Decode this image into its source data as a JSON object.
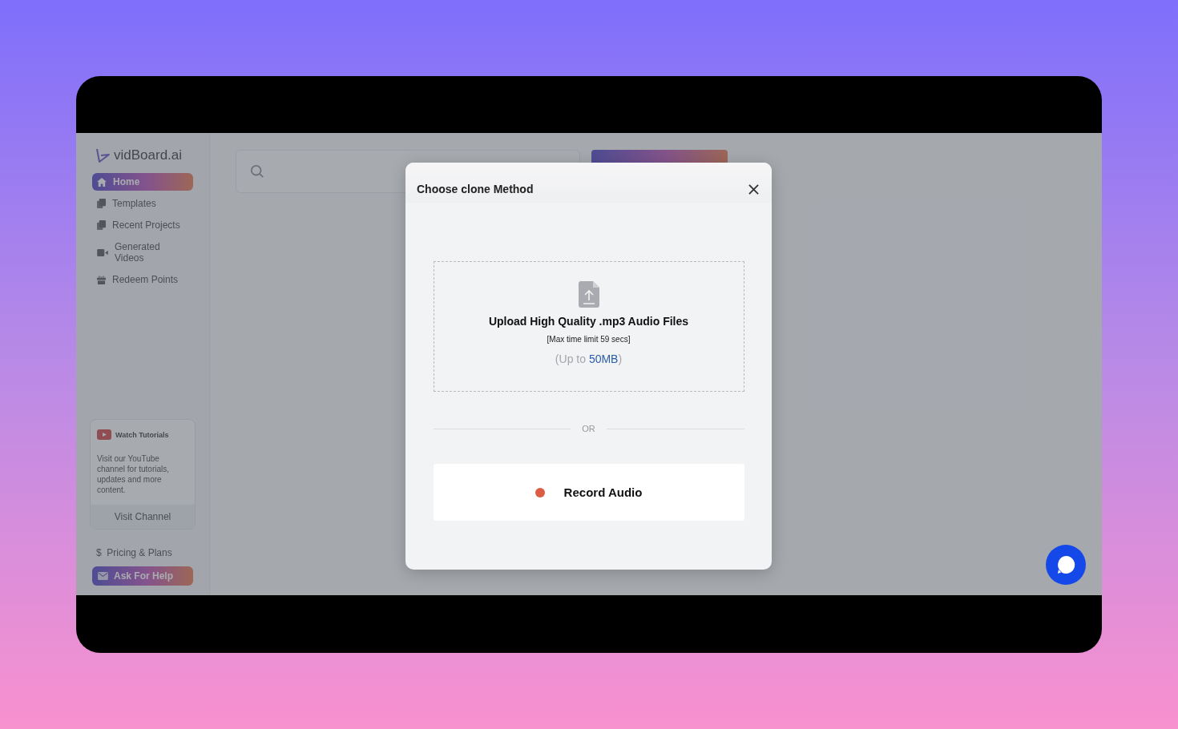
{
  "logo": {
    "text": "vidBoard.ai"
  },
  "sidebar": {
    "items": [
      {
        "label": "Home",
        "kind": "home",
        "selected": true
      },
      {
        "label": "Templates",
        "kind": "copy",
        "selected": false
      },
      {
        "label": "Recent Projects",
        "kind": "copy",
        "selected": false
      },
      {
        "label": "Generated Videos",
        "kind": "video",
        "selected": false
      },
      {
        "label": "Redeem Points",
        "kind": "gift",
        "selected": false
      }
    ],
    "tutorial_card": {
      "title": "Watch Tutorials",
      "text": "Visit our YouTube channel for tutorials, updates and more content.",
      "button": "Visit Channel"
    },
    "pricing": {
      "symbol": "$",
      "label": "Pricing & Plans"
    },
    "help_button": {
      "label": "Ask For Help"
    }
  },
  "modal": {
    "title": "Choose clone Method",
    "upload": {
      "title": "Upload High Quality .mp3 Audio Files",
      "hint": "[Max time limit 59 secs]",
      "size_note": "(Up to **50MB**)"
    },
    "divider": "OR",
    "record_button": {
      "label": "Record Audio"
    }
  }
}
